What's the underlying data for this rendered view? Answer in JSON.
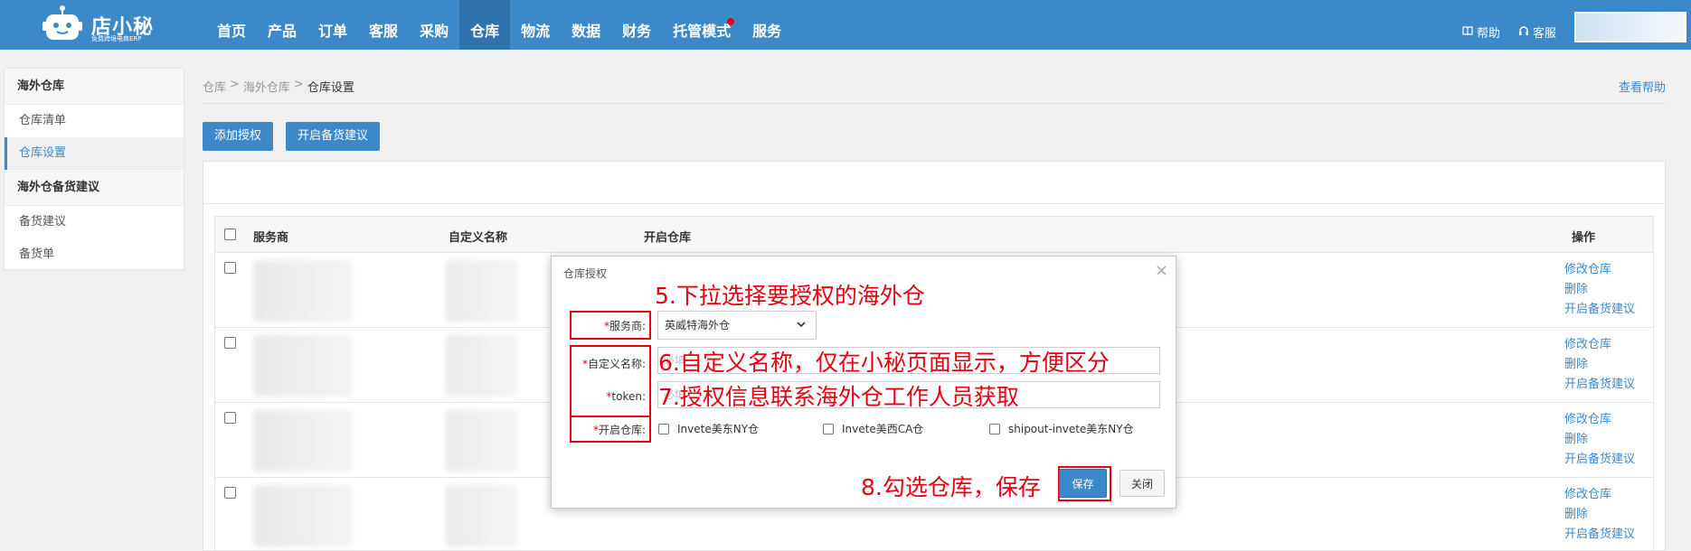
{
  "logo": {
    "title": "店小秘",
    "subtitle": "免费跨境电商ERP"
  },
  "nav": {
    "items": [
      "首页",
      "产品",
      "订单",
      "客服",
      "采购",
      "仓库",
      "物流",
      "数据",
      "财务",
      "托管模式",
      "服务"
    ],
    "active": "仓库"
  },
  "top_right": {
    "help": "帮助",
    "service": "客服"
  },
  "sidebar": {
    "group1": "海外仓库",
    "item1": "仓库清单",
    "item2": "仓库设置",
    "group2": "海外仓备货建议",
    "item3": "备货建议",
    "item4": "备货单"
  },
  "breadcrumb": {
    "c1": "仓库",
    "c2": "海外仓库",
    "current": "仓库设置",
    "sep": ">"
  },
  "help_link": "查看帮助",
  "buttons": {
    "add_auth": "添加授权",
    "enable_stock": "开启备货建议"
  },
  "table": {
    "headers": {
      "provider": "服务商",
      "custom_name": "自定义名称",
      "warehouse": "开启仓库",
      "ops": "操作"
    },
    "row_actions": [
      "修改仓库",
      "删除",
      "开启备货建议"
    ],
    "row_count": 4
  },
  "dialog": {
    "title": "仓库授权",
    "close": "×",
    "required_mark": "*",
    "provider_label": "服务商:",
    "provider_value": "英威特海外仓",
    "custom_name_label": "自定义名称:",
    "custom_name_placeholder": "必填",
    "token_label": "token:",
    "token_placeholder": "必填",
    "warehouse_label": "开启仓库:",
    "warehouses": [
      "Invete美东NY仓",
      "Invete美西CA仓",
      "shipout-invete美东NY仓"
    ],
    "save": "保存",
    "close_btn": "关闭"
  },
  "annotations": {
    "step5": "5.下拉选择要授权的海外仓",
    "step6": "6.自定义名称，仅在小秘页面显示，方便区分",
    "step7": "7.授权信息联系海外仓工作人员获取",
    "step8": "8.勾选仓库，保存"
  },
  "colors": {
    "primary": "#3b89c9",
    "annotation": "#e60012"
  }
}
